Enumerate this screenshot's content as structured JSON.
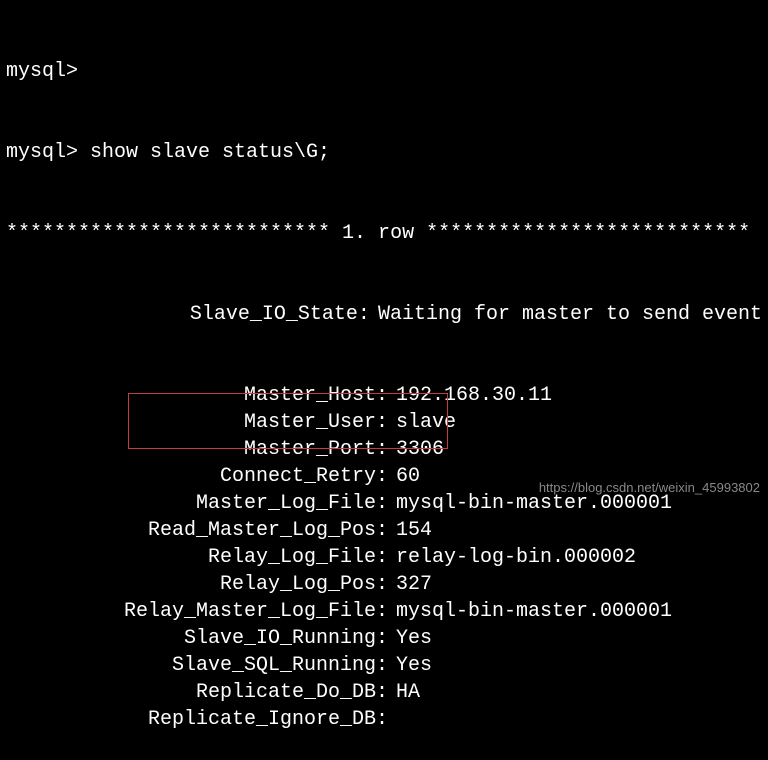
{
  "prompt1": "mysql>",
  "prompt2": "mysql> show slave status\\G;",
  "header": "*************************** 1. row ***************************",
  "first_key": "Slave_IO_State",
  "first_val": "Waiting for master to send event",
  "rows": [
    {
      "key": "Master_Host",
      "val": "192.168.30.11"
    },
    {
      "key": "Master_User",
      "val": "slave"
    },
    {
      "key": "Master_Port",
      "val": "3306"
    },
    {
      "key": "Connect_Retry",
      "val": "60"
    },
    {
      "key": "Master_Log_File",
      "val": "mysql-bin-master.000001"
    },
    {
      "key": "Read_Master_Log_Pos",
      "val": "154"
    },
    {
      "key": "Relay_Log_File",
      "val": "relay-log-bin.000002"
    },
    {
      "key": "Relay_Log_Pos",
      "val": "327"
    },
    {
      "key": "Relay_Master_Log_File",
      "val": "mysql-bin-master.000001"
    },
    {
      "key": "Slave_IO_Running",
      "val": "Yes"
    },
    {
      "key": "Slave_SQL_Running",
      "val": "Yes"
    },
    {
      "key": "Replicate_Do_DB",
      "val": "HA"
    },
    {
      "key": "Replicate_Ignore_DB",
      "val": ""
    }
  ],
  "watermark": "https://blog.csdn.net/weixin_45993802"
}
